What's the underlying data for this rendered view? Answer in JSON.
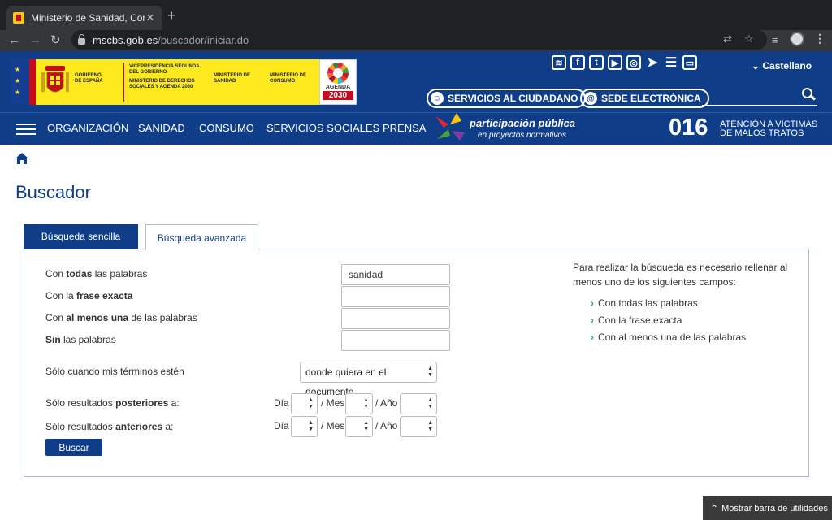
{
  "browser": {
    "tab_title": "Ministerio de Sanidad, Consum",
    "tab_close": "✕",
    "new_tab": "+",
    "url_host": "mscbs.gob.es",
    "url_path": "/buscador/iniciar.do"
  },
  "header": {
    "gov_label": "GOBIERNO DE ESPAÑA",
    "vicepresidencia": "VICEPRESIDENCIA SEGUNDA DEL GOBIERNO",
    "ministerio_derechos": "MINISTERIO DE DERECHOS SOCIALES Y AGENDA 2030",
    "ministerio_sanidad": "MINISTERIO DE SANIDAD",
    "ministerio_consumo": "MINISTERIO DE CONSUMO",
    "agenda_1": "AGENDA",
    "agenda_2": "2030",
    "language": "Castellano",
    "servicios_label": "SERVICIOS AL CIUDADANO",
    "sede_label": "SEDE ELECTRÓNICA",
    "social_icons": [
      "rss-icon",
      "facebook-icon",
      "twitter-icon",
      "youtube-icon",
      "instagram-icon",
      "telegram-icon",
      "list-icon",
      "monitor-icon"
    ]
  },
  "nav": {
    "items": [
      "ORGANIZACIÓN",
      "SANIDAD",
      "CONSUMO",
      "SERVICIOS SOCIALES",
      "PRENSA"
    ],
    "participacion_1": "participación pública",
    "participacion_2": "en proyectos normativos",
    "number_016": "016",
    "atencion": "ATENCIÓN A VICTIMAS",
    "malos_tratos": "DE MALOS TRATOS"
  },
  "page": {
    "title": "Buscador",
    "tab_simple": "Búsqueda sencilla",
    "tab_advanced": "Búsqueda avanzada"
  },
  "form": {
    "all_words_pre": "Con ",
    "all_words_bold": "todas",
    "all_words_post": " las palabras",
    "all_words_value": "sanidad",
    "exact_pre": "Con la ",
    "exact_bold": "frase exacta",
    "atleast_pre": "Con ",
    "atleast_bold": "al menos una",
    "atleast_post": " de las palabras",
    "without_bold": "Sin",
    "without_post": " las palabras",
    "terms_label": "Sólo cuando mis términos estén",
    "terms_value": "donde quiera en el documento",
    "after_pre": "Sólo resultados ",
    "after_bold": "posteriores",
    "after_post": " a:",
    "before_pre": "Sólo resultados ",
    "before_bold": "anteriores",
    "before_post": " a:",
    "dia": "Día",
    "mes": "/ Mes",
    "anio": "/ Año",
    "search_button": "Buscar"
  },
  "info": {
    "text": "Para realizar la búsqueda es necesario rellenar al menos uno de los siguientes campos:",
    "items": [
      "Con todas las palabras",
      "Con la frase exacta",
      "Con al menos una de las palabras"
    ]
  },
  "footer": {
    "toolbar_label": "Mostrar barra de utilidades"
  }
}
